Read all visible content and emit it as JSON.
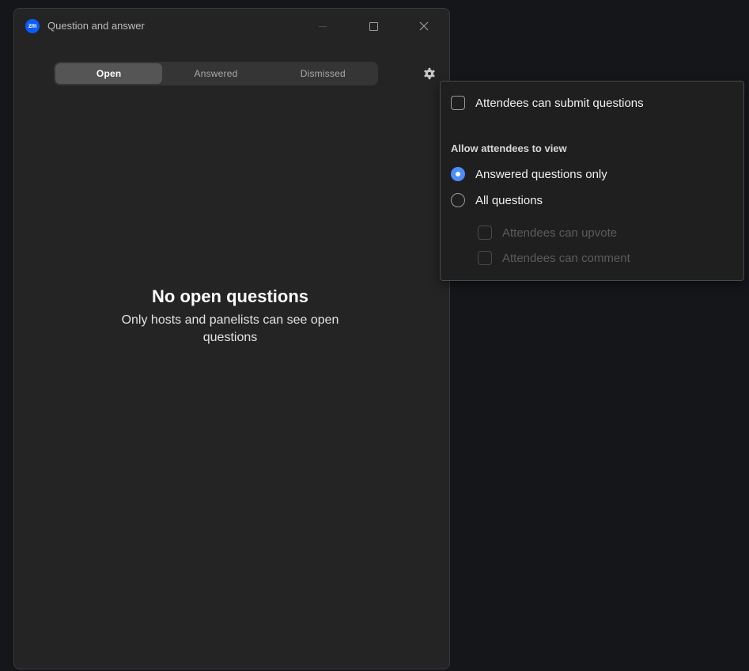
{
  "window": {
    "title": "Question and answer",
    "logo_text": "zm"
  },
  "tabs": [
    {
      "label": "Open",
      "active": true
    },
    {
      "label": "Answered",
      "active": false
    },
    {
      "label": "Dismissed",
      "active": false
    }
  ],
  "empty_state": {
    "title": "No open questions",
    "description": "Only hosts and panelists can see open questions"
  },
  "settings": {
    "submit_questions": {
      "label": "Attendees can submit questions",
      "checked": false
    },
    "view_section_label": "Allow attendees to view",
    "view_options": [
      {
        "label": "Answered questions only",
        "selected": true
      },
      {
        "label": "All questions",
        "selected": false
      }
    ],
    "sub_options": [
      {
        "label": "Attendees can upvote",
        "checked": false,
        "disabled": true
      },
      {
        "label": "Attendees can comment",
        "checked": false,
        "disabled": true
      }
    ]
  },
  "colors": {
    "accent": "#4c8dff",
    "brand": "#0b5cff",
    "window_bg": "#242424",
    "desktop_bg": "#14161a"
  },
  "icons": {
    "logo": "zoom-logo-icon",
    "settings": "gear-icon",
    "minimize": "minimize-icon",
    "maximize": "maximize-icon",
    "close": "close-icon"
  }
}
